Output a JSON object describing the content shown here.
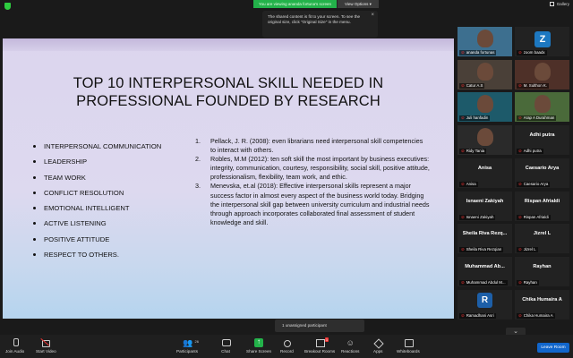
{
  "top": {
    "viewing": "You are viewing ananda fortuna's screen",
    "view_options": "View Options ▾",
    "gallery": "Gallery",
    "tip": "The shared content is fit to your screen. To see the original size, click \"Original Size\" in the menu.",
    "close": "×"
  },
  "slide": {
    "title_l1": "TOP 10 INTERPERSONAL SKILL NEEDED IN",
    "title_l2": "PROFESSIONAL FOUNDED BY RESEARCH",
    "skills": [
      "INTERPERSONAL COMMUNICATION",
      "LEADERSHIP",
      "TEAM WORK",
      "CONFLICT RESOLUTION",
      "EMOTIONAL INTELLIGENT",
      "ACTIVE LISTENING",
      "POSITIVE ATTITUDE",
      "RESPECT TO OTHERS."
    ],
    "refs": [
      {
        "n": "1.",
        "t": "Pellack, J. R. (2008): even librarians need interpersonal skill competencies to interact with others."
      },
      {
        "n": "2.",
        "t": "Robles, M.M (2012): ten soft skill the most important by business executives: integrity, communication, courtesy, responsibility, social skill, positive attitude, professionalism, flexibility, team work, and ethic."
      },
      {
        "n": "3.",
        "t": "Menevska, et.al (2018): Effective interpersonal skills represent a major success factor in almost every aspect of the business world today. Bridging the interpersonal skill gap between university curriculum and industrial needs through approach incorporates collaborated final assessment of student knowledge and skill."
      }
    ]
  },
  "participants": [
    {
      "big": "",
      "name": "ananda fortunas",
      "type": "video",
      "color": "#3d6f8f"
    },
    {
      "big": "",
      "name": "zoom baadx",
      "type": "z",
      "color": "#1d1d1d"
    },
    {
      "big": "",
      "name": "Catur A.S",
      "type": "video",
      "color": "#4a4038"
    },
    {
      "big": "",
      "name": "M. Sulthon K.",
      "type": "video",
      "color": "#4e3028"
    },
    {
      "big": "",
      "name": "Juli hanfadin",
      "type": "video",
      "color": "#1d5a6a"
    },
    {
      "big": "",
      "name": "Arap A Durahman",
      "type": "video",
      "color": "#4a6a3a"
    },
    {
      "big": "",
      "name": "Ridy Tania",
      "type": "video",
      "color": "#2a2a2a"
    },
    {
      "big": "Adhi putra",
      "name": "Adhi putra",
      "type": "name"
    },
    {
      "big": "Anisa",
      "name": "Anisa",
      "type": "name"
    },
    {
      "big": "Caesario Arya",
      "name": "Caesario Arya",
      "type": "name"
    },
    {
      "big": "Isnaeni Zakiyah",
      "name": "Isnaeni Zakiyah",
      "type": "name"
    },
    {
      "big": "Rispan Afrialdi",
      "name": "Rispan Afrialdi",
      "type": "name"
    },
    {
      "big": "Sheila Riva Rezq...",
      "name": "Sheila Riva Rezqian",
      "type": "name"
    },
    {
      "big": "Jizrel L",
      "name": "Jizrel L",
      "type": "name"
    },
    {
      "big": "Muhammad Ab...",
      "name": "Muhammad Abdul M...",
      "type": "name"
    },
    {
      "big": "Rayhan",
      "name": "Rayhan",
      "type": "name"
    },
    {
      "big": "",
      "name": "Ramadhani Asri",
      "type": "r"
    },
    {
      "big": "Chika Humaira A",
      "name": "Chika Humaira A",
      "type": "name"
    }
  ],
  "unassigned": "1 unassigned participant",
  "toolbar": {
    "join_audio": "Join Audio",
    "start_video": "Start Video",
    "participants": "Participants",
    "participants_count": "26",
    "chat": "Chat",
    "share": "Share Screen",
    "record": "Record",
    "breakout": "Breakout Rooms",
    "reactions": "Reactions",
    "apps": "Apps",
    "whiteboards": "Whiteboards",
    "leave": "Leave Room",
    "breakout_badge": "1"
  },
  "colors": {
    "share_green": "#23b24a",
    "leave_blue": "#1166cc",
    "muted_red": "#e33"
  }
}
